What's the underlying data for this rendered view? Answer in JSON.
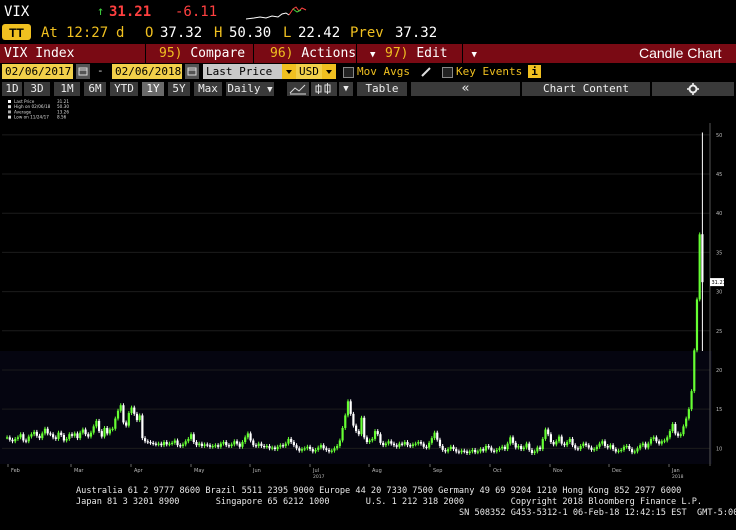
{
  "header": {
    "ticker": "VIX",
    "last": "31.21",
    "change": "-6.11",
    "arrow": "↑",
    "at_label": "At",
    "time": "12:27",
    "time_flag": "d",
    "open_label": "O",
    "open": "37.32",
    "high_label": "H",
    "high": "50.30",
    "low_label": "L",
    "low": "22.42",
    "prev_label": "Prev",
    "prev": "37.32"
  },
  "menu_bar": {
    "index": "VIX Index",
    "compare_num": "95)",
    "compare": "Compare",
    "actions_num": "96)",
    "actions": "Actions",
    "edit_num": "97)",
    "edit": "Edit",
    "chart_type": "Candle Chart"
  },
  "toolbar": {
    "start_date": "02/06/2017",
    "dash": "-",
    "end_date": "02/06/2018",
    "price_field": "Last Price",
    "currency": "USD",
    "mov_avgs": "Mov Avgs",
    "key_events": "Key Events",
    "info": "i"
  },
  "range_bar": {
    "ranges": [
      "1D",
      "3D",
      "1M",
      "6M",
      "YTD",
      "1Y",
      "5Y",
      "Max"
    ],
    "active_range": "1Y",
    "frequency": "Daily",
    "table": "Table",
    "collapse": "«",
    "chart_content": "Chart Content"
  },
  "legend": {
    "items": [
      {
        "label": "Last Price",
        "value": "31.21"
      },
      {
        "label": "High on 02/06/18",
        "value": "50.30"
      },
      {
        "label": "Average",
        "value": "13.26"
      },
      {
        "label": "Low on 11/24/17",
        "value": "8.56"
      }
    ]
  },
  "colors": {
    "up": "#66ff33",
    "down": "#ffffff",
    "accent": "#f0c020",
    "bar": "#7a0a14"
  },
  "chart_data": {
    "type": "candlestick",
    "ylim": [
      8,
      51
    ],
    "y_ticks": [
      10,
      15,
      20,
      25,
      30,
      35,
      40,
      45,
      50
    ],
    "last_price_tag": "31.21",
    "x_months": [
      "Feb",
      "Mar",
      "Apr",
      "May",
      "Jun",
      "Jul",
      "Aug",
      "Sep",
      "Oct",
      "Nov",
      "Dec",
      "Jan"
    ],
    "x_years": [
      "2017",
      "2018"
    ],
    "close": [
      11.4,
      11.1,
      10.9,
      11.2,
      11.4,
      11.8,
      11.0,
      10.9,
      11.5,
      11.8,
      12.1,
      11.6,
      11.3,
      11.9,
      12.5,
      11.9,
      11.8,
      11.4,
      11.2,
      12.0,
      11.7,
      11.0,
      11.2,
      11.8,
      11.6,
      11.9,
      11.3,
      12.0,
      12.4,
      11.8,
      11.5,
      12.0,
      12.8,
      13.5,
      12.2,
      11.5,
      12.6,
      11.9,
      12.4,
      12.5,
      13.8,
      14.8,
      15.5,
      13.3,
      12.9,
      14.5,
      15.2,
      14.4,
      13.6,
      14.2,
      11.3,
      10.9,
      10.8,
      10.7,
      10.6,
      10.5,
      10.6,
      10.4,
      10.8,
      10.5,
      10.6,
      10.7,
      11.0,
      10.4,
      10.3,
      10.5,
      10.9,
      11.2,
      11.8,
      10.8,
      10.4,
      10.6,
      10.3,
      10.5,
      10.4,
      10.2,
      10.3,
      10.4,
      10.2,
      10.6,
      10.8,
      10.4,
      10.3,
      10.5,
      10.9,
      10.6,
      10.2,
      10.8,
      11.4,
      11.9,
      11.0,
      10.4,
      10.3,
      10.6,
      10.3,
      10.2,
      10.3,
      10.0,
      10.1,
      9.9,
      10.2,
      10.4,
      10.3,
      10.6,
      11.2,
      10.8,
      10.4,
      10.0,
      9.7,
      9.9,
      10.0,
      10.2,
      9.9,
      9.6,
      9.8,
      10.1,
      10.4,
      10.0,
      9.8,
      9.6,
      9.7,
      10.0,
      10.3,
      11.0,
      12.6,
      14.2,
      16.0,
      14.4,
      12.9,
      12.2,
      11.8,
      13.9,
      11.4,
      10.8,
      11.0,
      11.2,
      12.2,
      11.8,
      10.7,
      10.4,
      10.6,
      10.9,
      10.6,
      10.4,
      10.2,
      10.6,
      10.5,
      10.8,
      10.4,
      10.3,
      10.5,
      10.6,
      10.8,
      10.6,
      10.2,
      10.1,
      10.7,
      11.3,
      12.0,
      11.1,
      10.3,
      9.8,
      9.6,
      9.9,
      10.2,
      9.9,
      9.6,
      9.5,
      9.7,
      9.6,
      9.4,
      9.6,
      9.8,
      9.5,
      9.6,
      9.9,
      9.7,
      10.3,
      10.1,
      9.7,
      9.6,
      9.8,
      10.0,
      10.2,
      9.9,
      10.6,
      11.4,
      10.7,
      10.1,
      10.3,
      9.9,
      10.1,
      10.6,
      9.8,
      9.4,
      9.6,
      10.1,
      9.9,
      11.2,
      12.4,
      11.8,
      10.8,
      10.5,
      10.9,
      11.5,
      10.6,
      10.4,
      10.8,
      11.2,
      10.4,
      10.0,
      9.9,
      10.3,
      10.6,
      10.4,
      10.1,
      9.8,
      9.9,
      10.2,
      10.6,
      10.9,
      10.3,
      10.1,
      10.4,
      9.9,
      9.6,
      9.7,
      9.8,
      10.2,
      10.3,
      9.9,
      9.5,
      9.6,
      10.0,
      10.4,
      10.6,
      10.1,
      10.6,
      11.2,
      11.4,
      10.9,
      10.6,
      10.9,
      11.0,
      11.4,
      12.2,
      13.1,
      11.9,
      11.6,
      11.8,
      12.8,
      13.8,
      15.0,
      17.3,
      22.5,
      29.0,
      37.3,
      31.2
    ]
  }
}
